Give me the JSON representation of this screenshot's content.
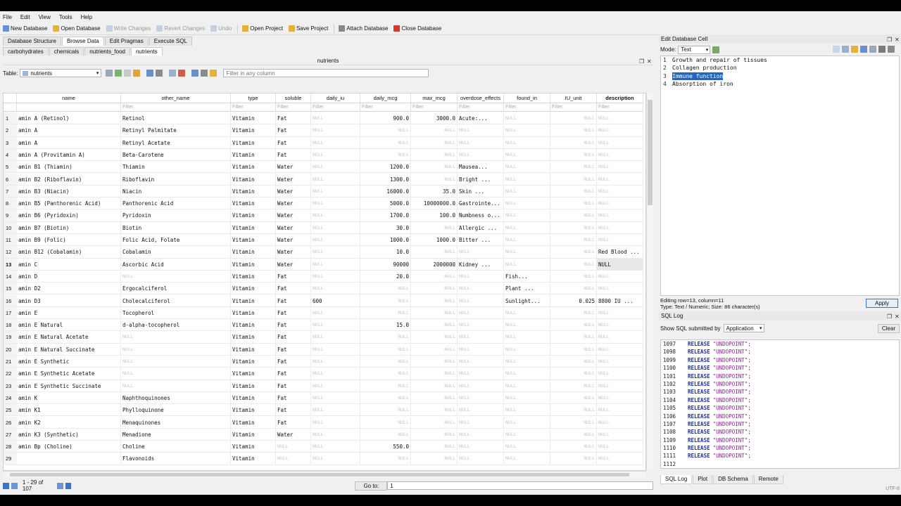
{
  "menu": [
    "File",
    "Edit",
    "View",
    "Tools",
    "Help"
  ],
  "toolbar": [
    {
      "label": "New Database",
      "icon": "new-database-icon",
      "color": "#6b8fd6",
      "disabled": false
    },
    {
      "label": "Open Database",
      "icon": "open-database-icon",
      "color": "#e2b23a",
      "disabled": false
    },
    {
      "label": "Write Changes",
      "icon": "write-changes-icon",
      "color": "#8aa1c8",
      "disabled": true
    },
    {
      "label": "Revert Changes",
      "icon": "revert-changes-icon",
      "color": "#8aa1c8",
      "disabled": true
    },
    {
      "label": "Undo",
      "icon": "undo-icon",
      "color": "#8aa1c8",
      "disabled": true
    },
    {
      "label": "Open Project",
      "icon": "open-project-icon",
      "color": "#e2b23a",
      "disabled": false
    },
    {
      "label": "Save Project",
      "icon": "save-project-icon",
      "color": "#e2b23a",
      "disabled": false
    },
    {
      "label": "Attach Database",
      "icon": "attach-database-icon",
      "color": "#888888",
      "disabled": false
    },
    {
      "label": "Close Database",
      "icon": "close-database-icon",
      "color": "#d23a2a",
      "disabled": false
    }
  ],
  "tabs": [
    "Database Structure",
    "Browse Data",
    "Edit Pragmas",
    "Execute SQL"
  ],
  "active_tab": 1,
  "subtabs": [
    "carbohydrates",
    "chemicals",
    "nutrients_food",
    "nutrients"
  ],
  "active_subtab": 3,
  "panel_title": "nutrients",
  "table_label": "Table:",
  "table_value": "nutrients",
  "filter_any_placeholder": "Filter in any column",
  "columns": [
    "name",
    "other_name",
    "type",
    "soluble",
    "daily_iu",
    "daily_mcg",
    "max_mcg",
    "overdose_effects",
    "found_in",
    "IU_unit",
    "description"
  ],
  "filter_placeholder": "Filter",
  "rows": [
    [
      "amin A (Retinol)",
      "Retinol",
      "Vitamin",
      "Fat",
      "NULL",
      "900.0",
      "3000.0",
      "Acute:...",
      "NULL",
      "NULL",
      "NULL"
    ],
    [
      "amin A",
      "Retinyl Palmitate",
      "Vitamin",
      "Fat",
      "NULL",
      "NULL",
      "NULL",
      "NULL",
      "NULL",
      "NULL",
      "NULL"
    ],
    [
      "amin A",
      "Retinyl Acetate",
      "Vitamin",
      "Fat",
      "NULL",
      "NULL",
      "NULL",
      "NULL",
      "NULL",
      "NULL",
      "NULL"
    ],
    [
      "amin A (Provitamin A)",
      "Beta-Carotene",
      "Vitamin",
      "Fat",
      "NULL",
      "NULL",
      "NULL",
      "NULL",
      "NULL",
      "NULL",
      "NULL"
    ],
    [
      "amin B1 (Thiamin)",
      "Thiamin",
      "Vitamin",
      "Water",
      "NULL",
      "1200.0",
      "NULL",
      "Mausea...",
      "NULL",
      "NULL",
      "NULL"
    ],
    [
      "amin B2 (Riboflavin)",
      "Riboflavin",
      "Vitamin",
      "Water",
      "NULL",
      "1300.0",
      "NULL",
      "Bright ...",
      "NULL",
      "NULL",
      "NULL"
    ],
    [
      "amin B3 (Niacin)",
      "Niacin",
      "Vitamin",
      "Water",
      "NULL",
      "16000.0",
      "35.0",
      "Skin ...",
      "NULL",
      "NULL",
      "NULL"
    ],
    [
      "amin B5 (Panthorenic Acid)",
      "Panthorenic Acid",
      "Vitamin",
      "Water",
      "NULL",
      "5000.0",
      "10000000.0",
      "Gastrointe...",
      "NULL",
      "NULL",
      "NULL"
    ],
    [
      "amin B6 (Pyridoxin)",
      "Pyridoxin",
      "Vitamin",
      "Water",
      "NULL",
      "1700.0",
      "100.0",
      "Numbness o...",
      "NULL",
      "NULL",
      "NULL"
    ],
    [
      "amin B7 (Biotin)",
      "Biotin",
      "Vitamin",
      "Water",
      "NULL",
      "30.0",
      "NULL",
      "Allergic ...",
      "NULL",
      "NULL",
      "NULL"
    ],
    [
      "amin B9 (Folic)",
      "Folic Acid, Folate",
      "Vitamin",
      "Water",
      "NULL",
      "1000.0",
      "1000.0",
      "Bitter ...",
      "NULL",
      "NULL",
      "NULL"
    ],
    [
      "amin B12 (Cobalamin)",
      "Cobalamin",
      "Vitamin",
      "Water",
      "NULL",
      "10.0",
      "NULL",
      "NULL",
      "NULL",
      "NULL",
      "Red Blood ..."
    ],
    [
      "amin C",
      "Ascorbic Acid",
      "Vitamin",
      "Water",
      "NULL",
      "90000",
      "2000000",
      "Kidney ...",
      "NULL",
      "NULL",
      "NULL"
    ],
    [
      "amin D",
      "NULL",
      "Vitamin",
      "Fat",
      "NULL",
      "20.0",
      "NULL",
      "NULL",
      "Fish...",
      "NULL",
      "NULL"
    ],
    [
      "amin D2",
      "Ergocalciferol",
      "Vitamin",
      "Fat",
      "NULL",
      "NULL",
      "NULL",
      "NULL",
      "Plant ...",
      "NULL",
      "NULL"
    ],
    [
      "amin D3",
      "Cholecalciferol",
      "Vitamin",
      "Fat",
      "600",
      "NULL",
      "NULL",
      "NULL",
      "Sunlight...",
      "0.025",
      "8800 IU ..."
    ],
    [
      "amin E",
      "Tocopherol",
      "Vitamin",
      "Fat",
      "NULL",
      "NULL",
      "NULL",
      "NULL",
      "NULL",
      "NULL",
      "NULL"
    ],
    [
      "amin E Natural",
      "d-alpha-tocopherol",
      "Vitamin",
      "Fat",
      "NULL",
      "15.0",
      "NULL",
      "NULL",
      "NULL",
      "NULL",
      "NULL"
    ],
    [
      "amin E Natural Acetate",
      "NULL",
      "Vitamin",
      "Fat",
      "NULL",
      "NULL",
      "NULL",
      "NULL",
      "NULL",
      "NULL",
      "NULL"
    ],
    [
      "amin E Natural Succinate",
      "NULL",
      "Vitamin",
      "Fat",
      "NULL",
      "NULL",
      "NULL",
      "NULL",
      "NULL",
      "NULL",
      "NULL"
    ],
    [
      "amin E Synthetic",
      "NULL",
      "Vitamin",
      "Fat",
      "NULL",
      "NULL",
      "NULL",
      "NULL",
      "NULL",
      "NULL",
      "NULL"
    ],
    [
      "amin E Synthetic Acetate",
      "NULL",
      "Vitamin",
      "Fat",
      "NULL",
      "NULL",
      "NULL",
      "NULL",
      "NULL",
      "NULL",
      "NULL"
    ],
    [
      "amin E Synthetic Succinate",
      "NULL",
      "Vitamin",
      "Fat",
      "NULL",
      "NULL",
      "NULL",
      "NULL",
      "NULL",
      "NULL",
      "NULL"
    ],
    [
      "amin K",
      "Naphthoquinones",
      "Vitamin",
      "Fat",
      "NULL",
      "NULL",
      "NULL",
      "NULL",
      "NULL",
      "NULL",
      "NULL"
    ],
    [
      "amin K1",
      "Phylloquinone",
      "Vitamin",
      "Fat",
      "NULL",
      "NULL",
      "NULL",
      "NULL",
      "NULL",
      "NULL",
      "NULL"
    ],
    [
      "amin K2",
      "Menaquinones",
      "Vitamin",
      "Fat",
      "NULL",
      "NULL",
      "NULL",
      "NULL",
      "NULL",
      "NULL",
      "NULL"
    ],
    [
      "amin K3 (Synthetic)",
      "Menadione",
      "Vitamin",
      "Water",
      "NULL",
      "NULL",
      "NULL",
      "NULL",
      "NULL",
      "NULL",
      "NULL"
    ],
    [
      "amin Bp (Choline)",
      "Choline",
      "Vitamin",
      "NULL",
      "NULL",
      "550.0",
      "NULL",
      "NULL",
      "NULL",
      "NULL",
      "NULL"
    ],
    [
      "",
      "Flavonoids",
      "Vitamin",
      "NULL",
      "NULL",
      "NULL",
      "NULL",
      "NULL",
      "NULL",
      "NULL",
      "NULL"
    ]
  ],
  "selected_row": 13,
  "record_text": "1 - 29 of 107",
  "goto_label": "Go to:",
  "goto_value": "1",
  "edit_cell": {
    "title": "Edit Database Cell",
    "mode_label": "Mode:",
    "mode_value": "Text",
    "lines": [
      "Growth and repair of tissues",
      "Collagen production",
      "Immune function",
      "Absorption of iron"
    ],
    "selected_line": 3,
    "status1": "Editing row=13, column=11",
    "status2": "Type: Text / Numeric; Size: 86 character(s)",
    "apply": "Apply"
  },
  "sql_log": {
    "title": "SQL Log",
    "show_label": "Show SQL submitted by",
    "show_value": "Application",
    "clear": "Clear",
    "lines": [
      {
        "n": "1097",
        "kw": "RELEASE",
        "s": "\"UNDOPOINT\";"
      },
      {
        "n": "1098",
        "kw": "RELEASE",
        "s": "\"UNDOPOINT\";"
      },
      {
        "n": "1099",
        "kw": "RELEASE",
        "s": "\"UNDOPOINT\";"
      },
      {
        "n": "1100",
        "kw": "RELEASE",
        "s": "\"UNDOPOINT\";"
      },
      {
        "n": "1101",
        "kw": "RELEASE",
        "s": "\"UNDOPOINT\";"
      },
      {
        "n": "1102",
        "kw": "RELEASE",
        "s": "\"UNDOPOINT\";"
      },
      {
        "n": "1103",
        "kw": "RELEASE",
        "s": "\"UNDOPOINT\";"
      },
      {
        "n": "1104",
        "kw": "RELEASE",
        "s": "\"UNDOPOINT\";"
      },
      {
        "n": "1105",
        "kw": "RELEASE",
        "s": "\"UNDOPOINT\";"
      },
      {
        "n": "1106",
        "kw": "RELEASE",
        "s": "\"UNDOPOINT\";"
      },
      {
        "n": "1107",
        "kw": "RELEASE",
        "s": "\"UNDOPOINT\";"
      },
      {
        "n": "1108",
        "kw": "RELEASE",
        "s": "\"UNDOPOINT\";"
      },
      {
        "n": "1109",
        "kw": "RELEASE",
        "s": "\"UNDOPOINT\";"
      },
      {
        "n": "1110",
        "kw": "RELEASE",
        "s": "\"UNDOPOINT\";"
      },
      {
        "n": "1111",
        "kw": "RELEASE",
        "s": "\"UNDOPOINT\";"
      },
      {
        "n": "1112",
        "kw": "",
        "s": ""
      }
    ],
    "bottom_tabs": [
      "SQL Log",
      "Plot",
      "DB Schema",
      "Remote"
    ],
    "active_bottom_tab": 0
  },
  "encoding": "UTF-8"
}
